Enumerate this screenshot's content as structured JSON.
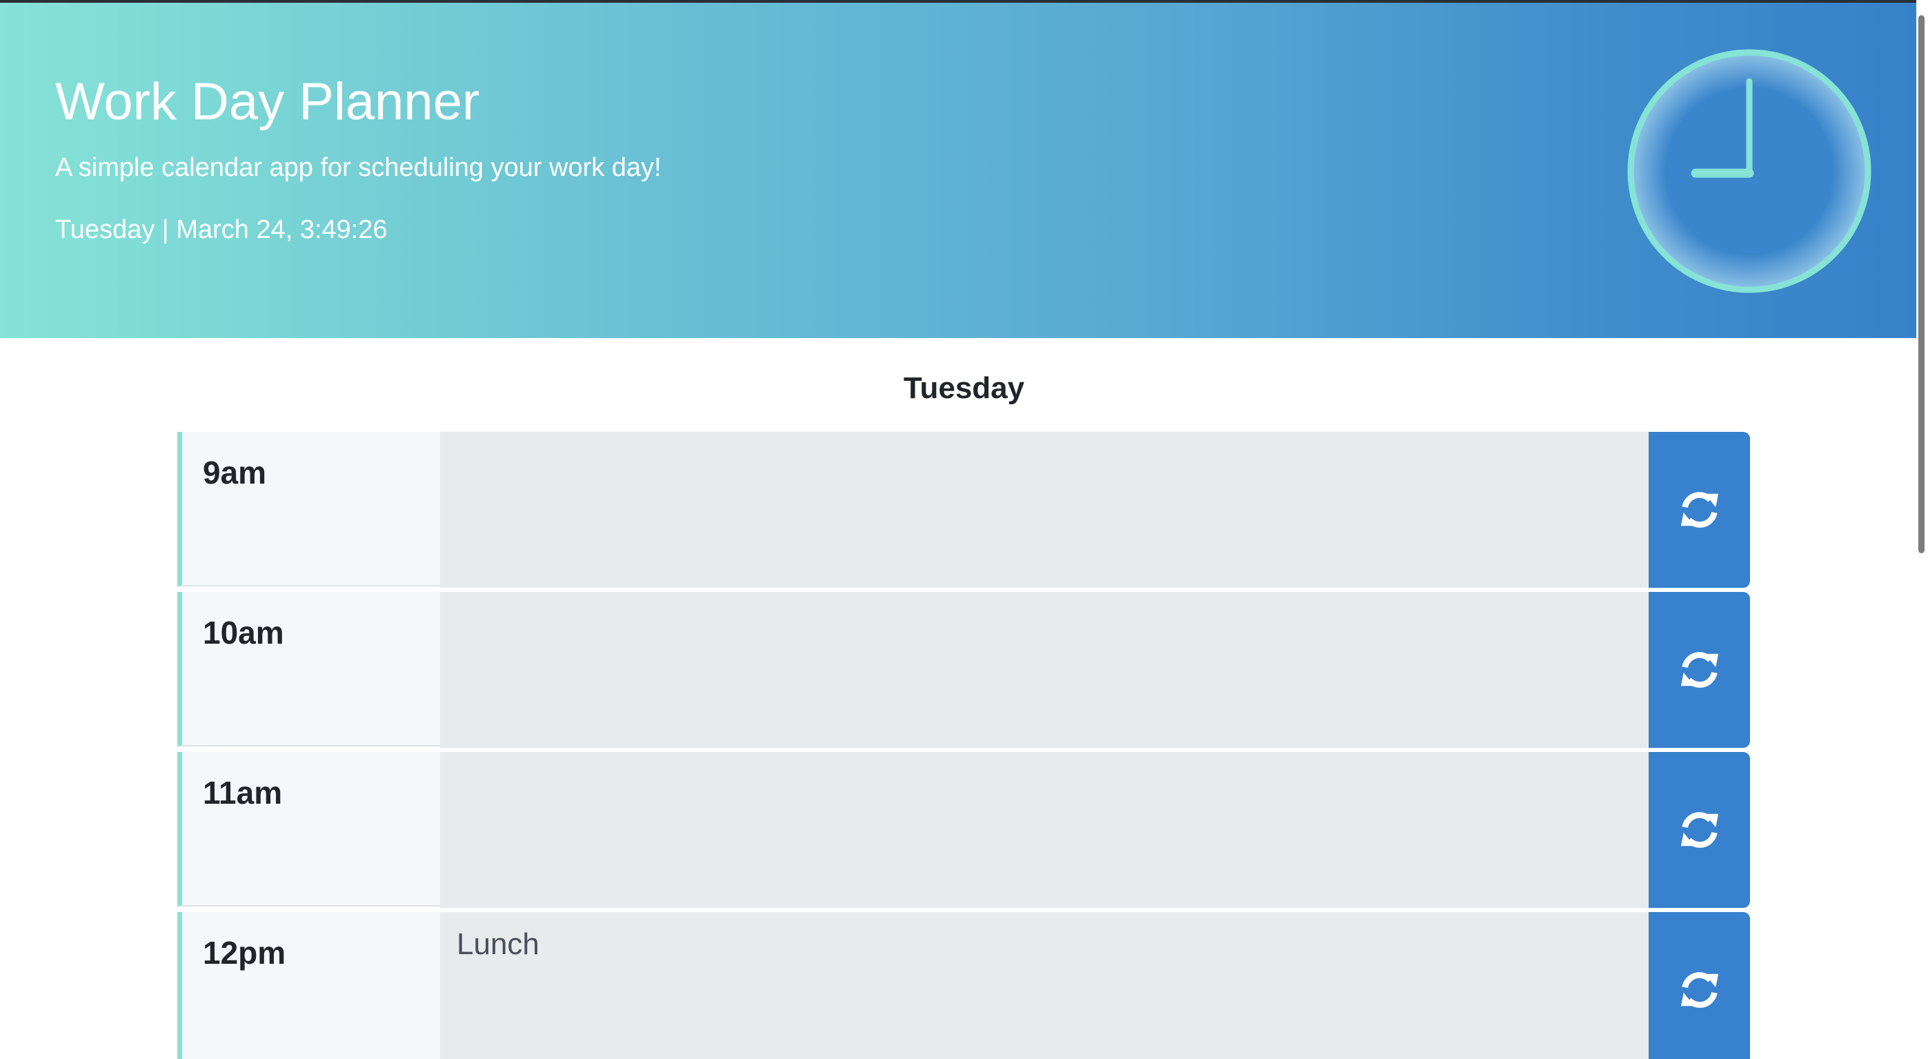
{
  "header": {
    "title": "Work Day Planner",
    "subtitle": "A simple calendar app for scheduling your work day!",
    "datetime": "Tuesday | March 24, 3:49:26",
    "clock_icon": "clock-icon"
  },
  "planner": {
    "day": "Tuesday",
    "blocks": [
      {
        "hour": "9am",
        "text": ""
      },
      {
        "hour": "10am",
        "text": ""
      },
      {
        "hour": "11am",
        "text": ""
      },
      {
        "hour": "12pm",
        "text": "Lunch"
      }
    ],
    "save_icon": "sync-icon"
  },
  "colors": {
    "gradient_start": "#86e3d6",
    "gradient_end": "#3781c9",
    "accent": "#86e3d6",
    "button": "#3781ce",
    "textarea_bg": "#e8ebee"
  }
}
